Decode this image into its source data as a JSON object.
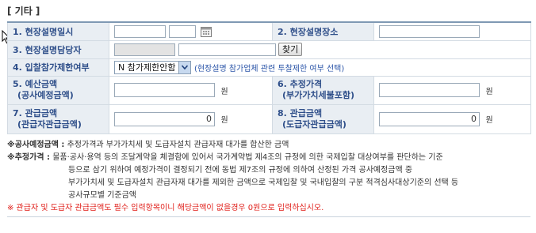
{
  "section": {
    "title": "[ 기타 ]"
  },
  "rows": {
    "briefing_date": {
      "label": "1. 현장설명일시",
      "date_value": "",
      "time_value": ""
    },
    "briefing_place": {
      "label": "2. 현장설명장소",
      "value": ""
    },
    "briefing_manager": {
      "label": "3. 현장설명담당자",
      "code_value": "",
      "name_value": "",
      "search_button": "찾기"
    },
    "bid_restriction": {
      "label": "4. 입찰참가제한여부",
      "select_value": "N 참가제한안함",
      "hint": "(현장설명 참가업체 관련 투찰제한 여부 선택)"
    },
    "budget": {
      "label_line1": "5. 예산금액",
      "label_line2": "(공사예정금액)",
      "value": "",
      "unit": "원"
    },
    "estimate": {
      "label_line1": "6. 추정가격",
      "label_line2": "(부가가치세불포함)",
      "value": "",
      "unit": "원"
    },
    "gov_material": {
      "label_line1": "7. 관급금액",
      "label_line2": "(관급자관급금액)",
      "value": "0",
      "unit": "원"
    },
    "contractor_material": {
      "label_line1": "8. 관급금액",
      "label_line2": "(도급자관급금액)",
      "value": "0",
      "unit": "원"
    }
  },
  "notes": {
    "n1_key": "※공사예정금액 :",
    "n1_text": "추정가격과 부가가치세 및 도급자설치 관급자재 대가를 합산한 금액",
    "n2_key": "※추정가격 :",
    "n2_line1": "물품·공사·용역 등의 조달계약을 체결함에 있어서 국가계약법 제4조의 규정에 의한 국제입찰 대상여부를 판단하는 기준",
    "n2_line2": "등으로 삼기 위하여 예정가격이 결정되기 전에 동법 제7조의 규정에 의하여 산정된 가격 공사예정금액 중",
    "n2_line3": "부가가치세 및 도급자설치 관급자재 대가를 제외한 금액으로 국제입찰 및 국내입찰의 구분 적격심사대상기준의 선택 등",
    "n2_line4": "공사규모별 기준금액",
    "n3_warning": "※ 관급자 및 도급자 관급금액도 필수 입력항목이니 해당금액이 없을경우 0원으로 입력하십시오."
  },
  "colors": {
    "label_bg": "#e9eef3",
    "label_text": "#2f4f8a",
    "warning": "#e0201b",
    "hint": "#2b55a8"
  },
  "icons": {
    "calendar": "calendar-icon",
    "dropdown": "chevron-down-icon",
    "cursor": "mouse-cursor-icon"
  }
}
